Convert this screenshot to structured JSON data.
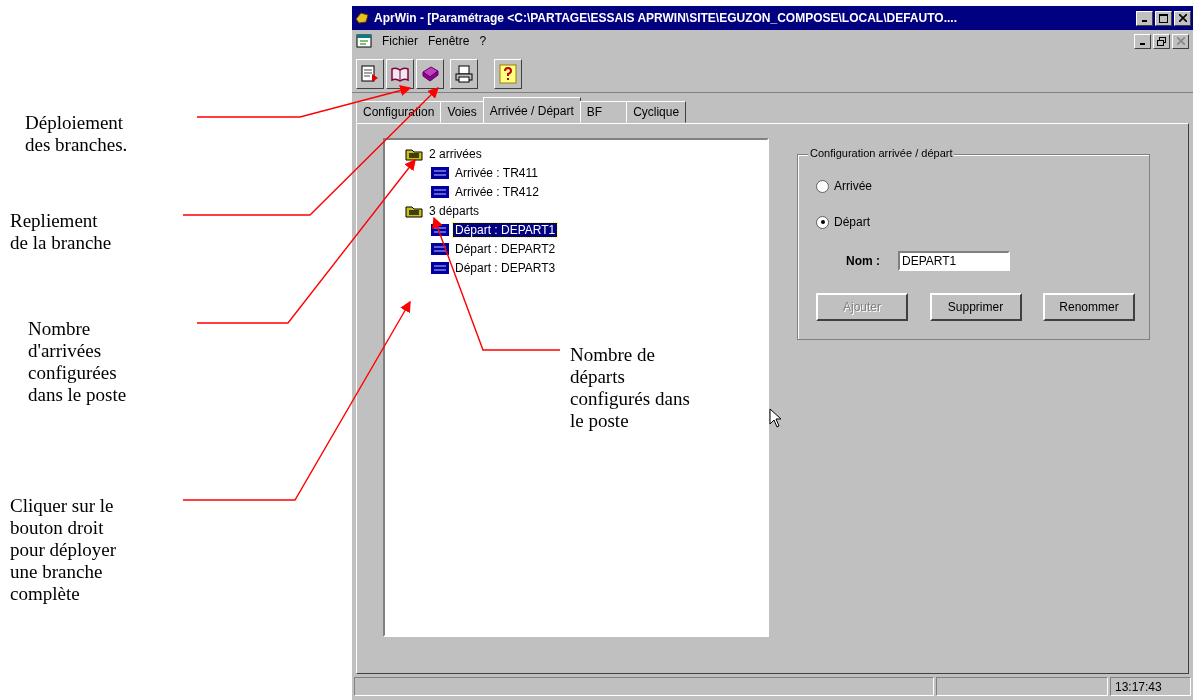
{
  "annotations": [
    {
      "text": "Déploiement\ndes branches."
    },
    {
      "text": "Repliement\nde la branche"
    },
    {
      "text": "Nombre\nd'arrivées\nconfigurées\ndans le poste"
    },
    {
      "text": "Cliquer sur le\nbouton droit\npour déployer\nune branche\ncomplète"
    },
    {
      "text": "Nombre de\ndéparts\nconfigurés dans\nle poste"
    }
  ],
  "window": {
    "title": "AprWin  - [Paramétrage  <C:\\PARTAGE\\ESSAIS APRWIN\\SITE\\EGUZON_COMPOSE\\LOCAL\\DEFAUTO...."
  },
  "menu": [
    {
      "label": "Fichier"
    },
    {
      "label": "Fenêtre"
    },
    {
      "label": "?"
    }
  ],
  "tabs": [
    {
      "label": "Configuration",
      "selected": false
    },
    {
      "label": "Voies",
      "selected": false
    },
    {
      "label": "Arrivée / Départ",
      "selected": true
    },
    {
      "label": "BF",
      "selected": false
    },
    {
      "label": "Cyclique",
      "selected": false
    }
  ],
  "tree": [
    {
      "label": "2 arrivées",
      "kind": "folder",
      "selected": false,
      "children": [
        {
          "label": "Arrivée : TR411",
          "kind": "item",
          "selected": false
        },
        {
          "label": "Arrivée : TR412",
          "kind": "item",
          "selected": false
        }
      ]
    },
    {
      "label": "3 départs",
      "kind": "folder",
      "selected": false,
      "children": [
        {
          "label": "Départ : DEPART1",
          "kind": "item",
          "selected": true
        },
        {
          "label": "Départ : DEPART2",
          "kind": "item",
          "selected": false
        },
        {
          "label": "Départ : DEPART3",
          "kind": "item",
          "selected": false
        }
      ]
    }
  ],
  "group": {
    "title": "Configuration arrivée / départ",
    "radios": [
      {
        "label": "Arrivée",
        "selected": false
      },
      {
        "label": "Départ",
        "selected": true
      }
    ],
    "name_label": "Nom :",
    "name_value": "DEPART1",
    "buttons": [
      {
        "label": "Ajouter",
        "disabled": true
      },
      {
        "label": "Supprimer",
        "disabled": false
      },
      {
        "label": "Renommer",
        "disabled": false
      }
    ]
  },
  "status_bar": {
    "time": "13:17:43"
  }
}
